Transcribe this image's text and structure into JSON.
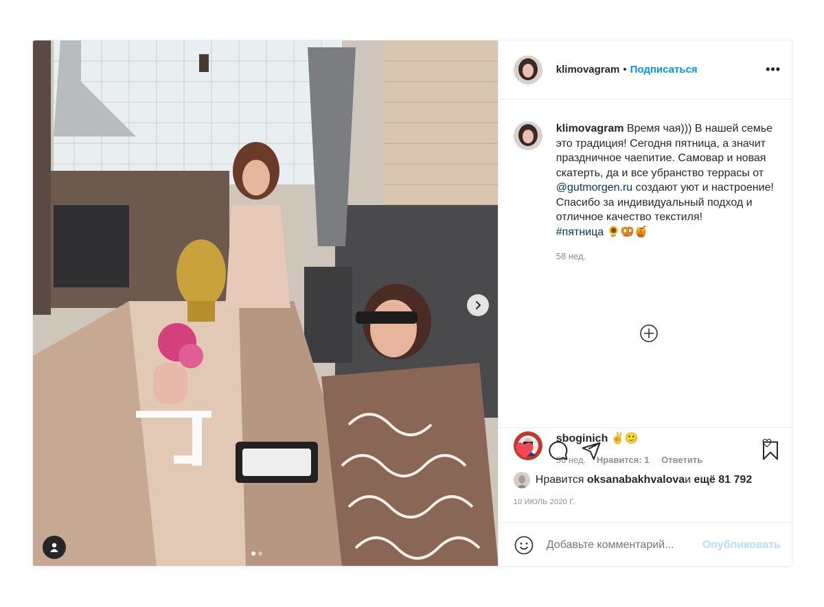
{
  "post": {
    "username": "klimovagram",
    "separator": "•",
    "follow_label": "Подписаться",
    "more_label": "•••",
    "caption_user": "klimovagram",
    "caption_text_1": "Время чая))) В нашей семье это традиция! Сегодня пятница, а значит праздничное чаепитие. Самовар и новая скатерть, да и все убранство террасы от ",
    "caption_mention": "@gutmorgen.ru",
    "caption_text_2": " создают уют и настроение! Спасибо за индивидуальный подход и отличное качество текстиля!",
    "caption_hashtag": "#пятница",
    "caption_emoji": "🌻🥨🍯",
    "caption_time": "58 нед.",
    "comment": {
      "user": "sboginich",
      "text": "✌️🙂",
      "time": "56 нед.",
      "likes": "Нравится: 1",
      "reply": "Ответить"
    },
    "likes_prefix": "Нравится ",
    "likes_user": "oksanabakhvalova",
    "likes_mid": " и ",
    "likes_count": "ещё 81 792",
    "date": "10 ИЮЛЬ 2020 Г.",
    "comment_placeholder": "Добавьте комментарий...",
    "publish_label": "Опубликовать"
  },
  "colors": {
    "accent": "#0095f6",
    "like": "#ed4956",
    "publish_disabled": "#b2dffc"
  },
  "icons": [
    "chevron-right-icon",
    "user-tag-icon",
    "heart-icon",
    "comment-icon",
    "share-icon",
    "bookmark-icon",
    "plus-circle-icon",
    "emoji-icon"
  ]
}
